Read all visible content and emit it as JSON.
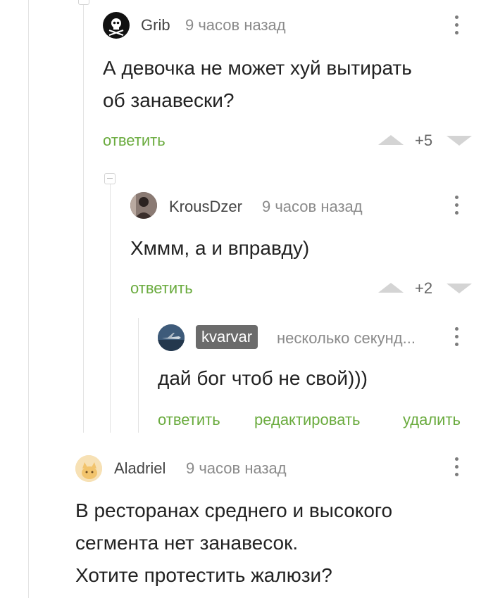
{
  "comments": [
    {
      "username": "Grib",
      "time": "9 часов назад",
      "text_lines": [
        "А девочка не может хуй вытирать",
        "об занавески?"
      ],
      "reply_label": "ответить",
      "rating": "+5"
    },
    {
      "username": "KrousDzer",
      "time": "9 часов назад",
      "text_lines": [
        "Хммм, а и вправду)"
      ],
      "reply_label": "ответить",
      "rating": "+2"
    },
    {
      "username": "kvarvar",
      "time": "несколько секунд...",
      "text_lines": [
        "дай бог чтоб не свой)))"
      ],
      "reply_label": "ответить",
      "edit_label": "редактировать",
      "delete_label": "удалить"
    },
    {
      "username": "Aladriel",
      "time": "9 часов назад",
      "text_lines": [
        "В ресторанах среднего и высокого",
        "сегмента нет занавесок.",
        "Хотите протестить жалюзи?"
      ]
    }
  ],
  "colors": {
    "action_green": "#6aab3e",
    "badge_gray": "#6b6b6b"
  }
}
